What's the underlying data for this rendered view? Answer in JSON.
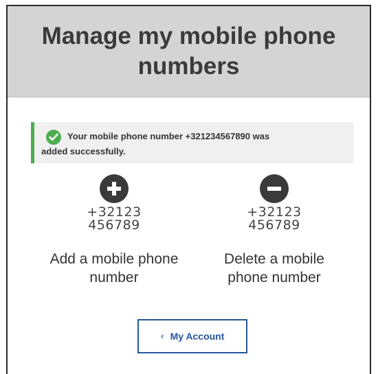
{
  "header": {
    "title": "Manage my mobile phone numbers"
  },
  "alert": {
    "line1": "Your mobile phone number +321234567890 was",
    "line2": "added successfully.",
    "icon": "check-circle-icon",
    "color": "#4cae4f"
  },
  "actions": {
    "add": {
      "icon": "plus-circle-icon",
      "number_line1": "+32123",
      "number_line2": "456789",
      "label_line1": "Add a mobile phone",
      "label_line2": "number"
    },
    "delete": {
      "icon": "minus-circle-icon",
      "number_line1": "+32123",
      "number_line2": "456789",
      "label_line1": "Delete a mobile",
      "label_line2": "phone number"
    }
  },
  "account_button": {
    "chevron": "‹",
    "label": "My Account",
    "color": "#26569b"
  }
}
